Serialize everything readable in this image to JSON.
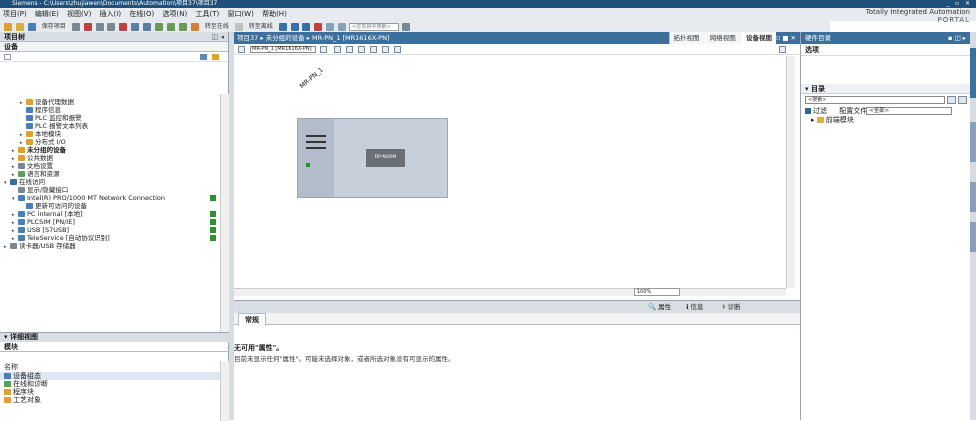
{
  "titlebar": {
    "text": "Siemens - C:\\Users\\zhujiawen\\Documents\\Automation\\项目37\\项目37",
    "controls": "_ ▫ ✕"
  },
  "menubar": {
    "items": [
      "项目(P)",
      "编辑(E)",
      "视图(V)",
      "插入(I)",
      "在线(O)",
      "选项(N)",
      "工具(T)",
      "窗口(W)",
      "帮助(H)"
    ]
  },
  "brand": {
    "line1": "Totally Integrated Automation",
    "line2": "PORTAL"
  },
  "toolbar": {
    "save_label": "保存项目",
    "go_online": "转至在线",
    "go_offline": "转至离线",
    "search_placeholder": "<在项目中搜索>"
  },
  "project_tree": {
    "title": "项目树",
    "devices_tab": "设备",
    "controls": "◫ ◂",
    "items": [
      {
        "label": "设备代理数据",
        "level": 2,
        "icon": "folder",
        "twisty": "▸"
      },
      {
        "label": "程序信息",
        "level": 2,
        "icon": "info",
        "twisty": ""
      },
      {
        "label": "PLC 监控和报警",
        "level": 2,
        "icon": "alarm",
        "twisty": ""
      },
      {
        "label": "PLC 报警文本列表",
        "level": 2,
        "icon": "list",
        "twisty": ""
      },
      {
        "label": "本地模块",
        "level": 2,
        "icon": "folder",
        "twisty": "▸"
      },
      {
        "label": "分布式 I/O",
        "level": 2,
        "icon": "folder",
        "twisty": "▸"
      },
      {
        "label": "未分组的设备",
        "level": 1,
        "icon": "folder",
        "twisty": "▸",
        "bold": true
      },
      {
        "label": "公共数据",
        "level": 1,
        "icon": "folder",
        "twisty": "▸"
      },
      {
        "label": "文档设置",
        "level": 1,
        "icon": "doc",
        "twisty": "▸"
      },
      {
        "label": "语言和资源",
        "level": 1,
        "icon": "lang",
        "twisty": "▸"
      },
      {
        "label": "在线访问",
        "level": 0,
        "icon": "online",
        "twisty": "▾"
      },
      {
        "label": "显示/隐藏接口",
        "level": 1,
        "icon": "filter",
        "twisty": ""
      },
      {
        "label": "Intel(R) PRO/1000 MT Network Connection",
        "level": 1,
        "icon": "net",
        "twisty": "▾",
        "status": true
      },
      {
        "label": "更新可访问的设备",
        "level": 2,
        "icon": "update",
        "twisty": ""
      },
      {
        "label": "PC internal [本地]",
        "level": 1,
        "icon": "net",
        "twisty": "▸",
        "status": true
      },
      {
        "label": "PLCSIM [PN/IE]",
        "level": 1,
        "icon": "net",
        "twisty": "▸",
        "status": true
      },
      {
        "label": "USB [S7USB]",
        "level": 1,
        "icon": "net",
        "twisty": "▸",
        "status": true
      },
      {
        "label": "TeleService [自动协议识别]",
        "level": 1,
        "icon": "net",
        "twisty": "▸",
        "status": true
      },
      {
        "label": "读卡器/USB 存储器",
        "level": 0,
        "icon": "card",
        "twisty": "▸"
      }
    ]
  },
  "detail_view": {
    "title": "详细视图",
    "tab": "模块",
    "column": "名称",
    "items": [
      "设备组态",
      "在线和诊断",
      "程序块",
      "工艺对象"
    ]
  },
  "editor": {
    "breadcrumb": "项目37 ▸ 未分组的设备 ▸ MR-PN_1 [MR1616X-PN]",
    "controls": "_ ▫ ■ ✕",
    "views": [
      "拓扑视图",
      "网络视图",
      "设备视图"
    ],
    "device_select": "MR-PN_1 [MR1616X-PN]",
    "device_name": "MR-PN_1",
    "module_label": "DP-NORM",
    "zoom": "100%"
  },
  "properties": {
    "tabs": [
      "属性",
      "信息",
      "诊断"
    ],
    "general_tab": "常规",
    "no_props_title": "无可用\"属性\"。",
    "no_props_text": "目前未显示任何\"属性\"。可能未选择对象，或者所选对象没有可显示的属性。"
  },
  "catalog": {
    "title": "硬件目录",
    "options": "选项",
    "section": "目录",
    "search_placeholder": "<搜索>",
    "filter_label": "过滤",
    "profile_label": "配置文件",
    "profile_value": "<全部>",
    "node": "前端模块"
  },
  "colors": {
    "accent": "#3d6f9c",
    "titlebar": "#20507a",
    "status_green": "#2f8f2f"
  }
}
